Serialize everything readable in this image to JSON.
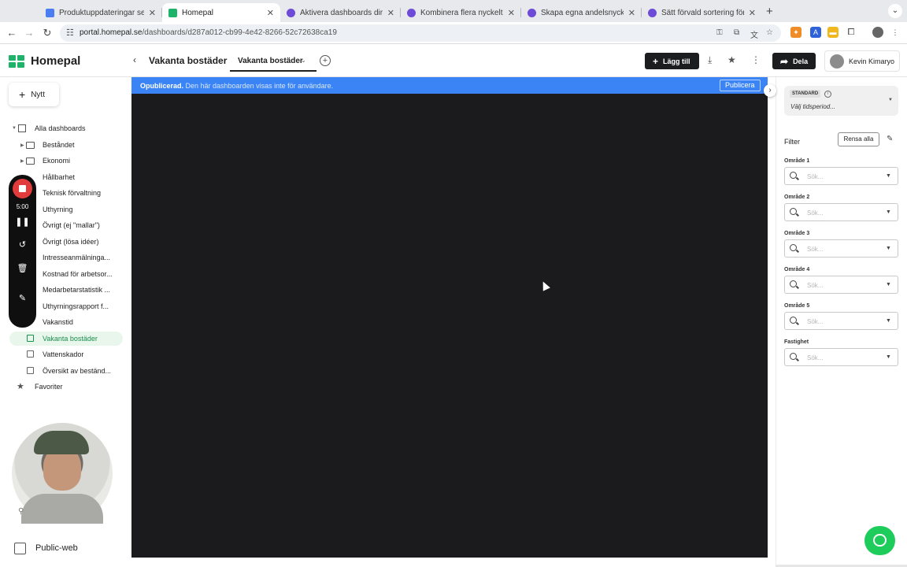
{
  "browser": {
    "tabs": [
      {
        "title": "Produktuppdateringar septem",
        "color": "#4a7cf3"
      },
      {
        "title": "Homepal",
        "color": "#1db46a"
      },
      {
        "title": "Aktivera dashboards direkt fr",
        "color": "#6d4ad8"
      },
      {
        "title": "Kombinera flera nyckeltal i en",
        "color": "#6d4ad8"
      },
      {
        "title": "Skapa egna andelsnyckeltal -",
        "color": "#6d4ad8"
      },
      {
        "title": "Sätt förvald sortering för bätt",
        "color": "#6d4ad8"
      }
    ],
    "url_host": "portal.homepal.se",
    "url_path": "/dashboards/d287a012-cb99-4e42-8266-52c72638ca19"
  },
  "header": {
    "brand": "Homepal",
    "dashboard_title": "Vakanta bostäder",
    "tab_label": "Vakanta bostäder",
    "add_label": "Lägg till",
    "share_label": "Dela",
    "user_name": "Kevin Kimaryo"
  },
  "sidebar": {
    "new_label": "Nytt",
    "all_label": "Alla dashboards",
    "folders": [
      "Beståndet",
      "Ekonomi",
      "Hållbarhet",
      "Teknisk förvaltning",
      "Uthyrning",
      "Övrigt (ej \"mallar\")",
      "Övrigt (lösa idéer)"
    ],
    "dashboards": [
      "Intresseanmälninga...",
      "Kostnad för arbetsor...",
      "Medarbetarstatistik ...",
      "Uthyrningsrapport f...",
      "Vakanstid",
      "Vakanta bostäder",
      "Vattenskador",
      "Översikt av beständ..."
    ],
    "favorites_label": "Favoriter",
    "workspace_label": "Public-web"
  },
  "recorder": {
    "time": "5:00"
  },
  "banner": {
    "status": "Opublicerad.",
    "message": " Den här dashboarden visas inte för användare.",
    "publish_label": "Publicera"
  },
  "rightpanel": {
    "period_badge": "STANDARD",
    "period_placeholder": "Välj tidsperiod...",
    "filter_label": "Filter",
    "clear_label": "Rensa alla",
    "filters": [
      {
        "label": "Område 1",
        "placeholder": "Sök..."
      },
      {
        "label": "Område 2",
        "placeholder": "Sök..."
      },
      {
        "label": "Område 3",
        "placeholder": "Sök..."
      },
      {
        "label": "Område 4",
        "placeholder": "Sök..."
      },
      {
        "label": "Område 5",
        "placeholder": "Sök..."
      },
      {
        "label": "Fastighet",
        "placeholder": "Sök..."
      }
    ]
  },
  "colors": {
    "brand": "#1db46a",
    "banner": "#3b84f5",
    "canvas": "#1b1b1d",
    "chat": "#1ecc5b"
  }
}
